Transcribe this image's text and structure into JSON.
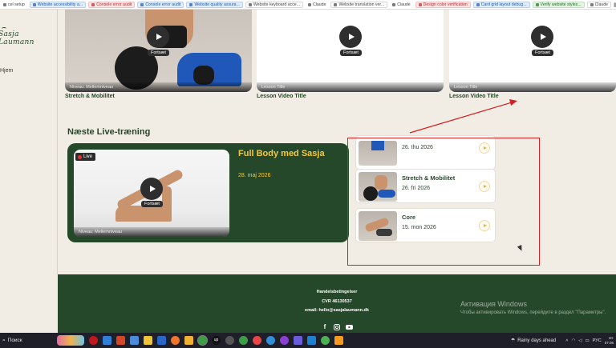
{
  "bookmarks": [
    {
      "label": "cel setup",
      "style": "nb"
    },
    {
      "label": "Website accessibility a...",
      "style": "blue"
    },
    {
      "label": "Console error audit",
      "style": "red"
    },
    {
      "label": "Console error audit",
      "style": "blue"
    },
    {
      "label": "Website quality assura...",
      "style": "blue"
    },
    {
      "label": "Website keyboard acce...",
      "style": "plain"
    },
    {
      "label": "Claude",
      "style": "nb"
    },
    {
      "label": "Website translation ver...",
      "style": "plain"
    },
    {
      "label": "Claude",
      "style": "nb"
    },
    {
      "label": "Design color verification",
      "style": "red"
    },
    {
      "label": "Card grid layout debug...",
      "style": "blue"
    },
    {
      "label": "Verify website styles...",
      "style": "green"
    },
    {
      "label": "Claude",
      "style": "plain"
    }
  ],
  "sidebar": {
    "brand": "Sasja Laumann",
    "nav_item": "Hjem"
  },
  "lessons": [
    {
      "title": "Stretch & Mobilitet",
      "play_label": "Fortsæt",
      "level": "Niveau: Mellemniveau",
      "has_photo": true
    },
    {
      "title": "Lesson Video Title",
      "play_label": "Fortsæt",
      "level": "Lesson Title",
      "has_photo": false
    },
    {
      "title": "Lesson Video Title",
      "play_label": "Fortsæt",
      "level": "Lesson Title",
      "has_photo": false
    }
  ],
  "live_section": {
    "title": "Næste Live-træning",
    "featured": {
      "badge": "Live",
      "play_label": "Fortsæt",
      "level": "Niveau: Mellemniveau",
      "title": "Full Body med Sasja",
      "date": "28. maj 2026"
    },
    "sessions": [
      {
        "title": "",
        "date": "26. thu 2026"
      },
      {
        "title": "Stretch & Mobilitet",
        "date": "26. fri 2026"
      },
      {
        "title": "Core",
        "date": "15. mon 2026"
      }
    ]
  },
  "footer": {
    "terms": "Handelsbetingelser",
    "cvr": "CVR 46130537",
    "email": "email: hello@sasjalaumann.dk",
    "icons": [
      "facebook-icon",
      "instagram-icon",
      "youtube-icon"
    ]
  },
  "windows_watermark": {
    "title": "Активация Windows",
    "subtitle": "Чтобы активировать Windows, перейдите в раздел \"Параметры\"."
  },
  "taskbar": {
    "search": "Поиск",
    "weather": "Rainy days ahead",
    "language": "РУС",
    "time": "10:",
    "date": "07.05"
  },
  "colors": {
    "brand_green": "#26482a",
    "accent_yellow": "#f3c83c",
    "page_bg": "#f2ede4",
    "annotation_red": "#d62020"
  }
}
